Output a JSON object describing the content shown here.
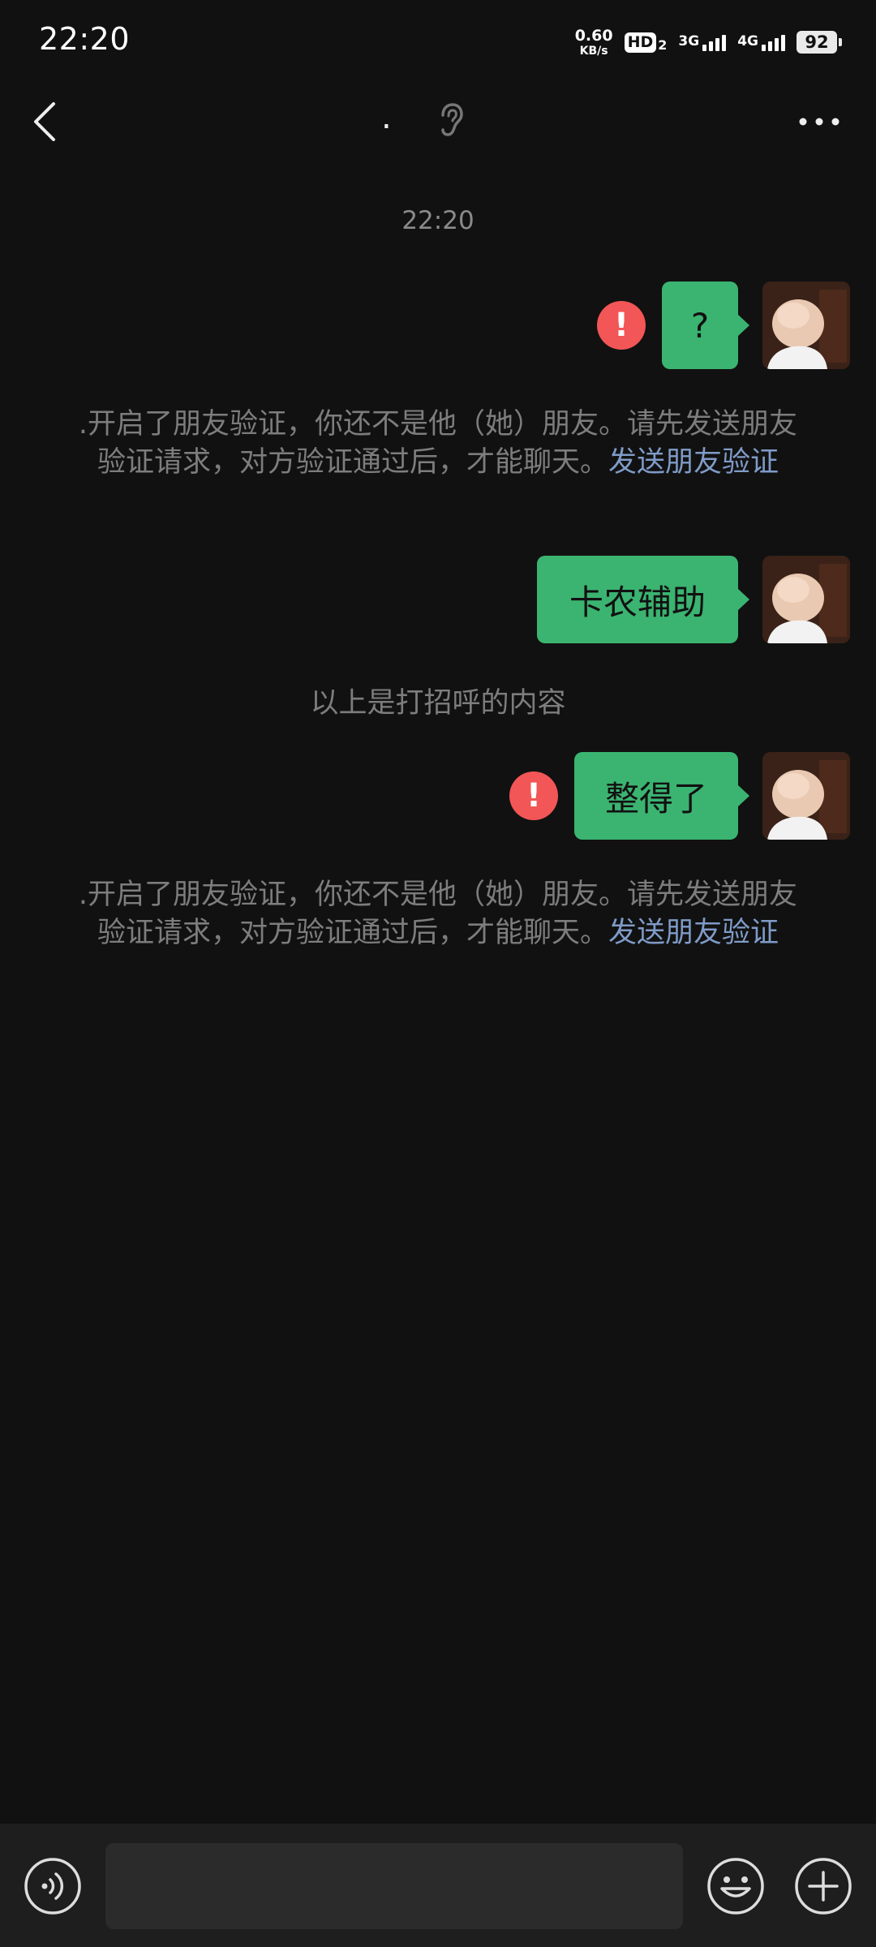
{
  "status_bar": {
    "time": "22:20",
    "net_speed_value": "0.60",
    "net_speed_unit": "KB/s",
    "hd_label": "HD",
    "hd_sub": "2",
    "signal_1_label": "3G",
    "signal_2_label": "4G",
    "battery": "92"
  },
  "nav": {
    "title": ".",
    "back_icon": "chevron-left-icon",
    "ear_icon": "ear-icon",
    "more_icon": "more-dots-icon"
  },
  "chat": {
    "timestamp": "22:20",
    "messages": [
      {
        "text": "?",
        "failed": true
      },
      {
        "text": "卡农辅助",
        "failed": false
      },
      {
        "text": "整得了",
        "failed": true
      }
    ],
    "error_glyph": "!",
    "system_notes": [
      {
        "text": ".开启了朋友验证，你还不是他（她）朋友。请先发送朋友验证请求，对方验证通过后，才能聊天。",
        "link": "发送朋友验证"
      },
      {
        "text": ".开启了朋友验证，你还不是他（她）朋友。请先发送朋友验证请求，对方验证通过后，才能聊天。",
        "link": "发送朋友验证"
      }
    ],
    "greeting_divider": "以上是打招呼的内容"
  },
  "input_bar": {
    "placeholder": "",
    "voice_icon": "voice-icon",
    "emoji_icon": "emoji-icon",
    "plus_icon": "plus-circle-icon"
  },
  "colors": {
    "background": "#111111",
    "bubble": "#3bb471",
    "error": "#f25656",
    "link": "#7f9bc8"
  }
}
